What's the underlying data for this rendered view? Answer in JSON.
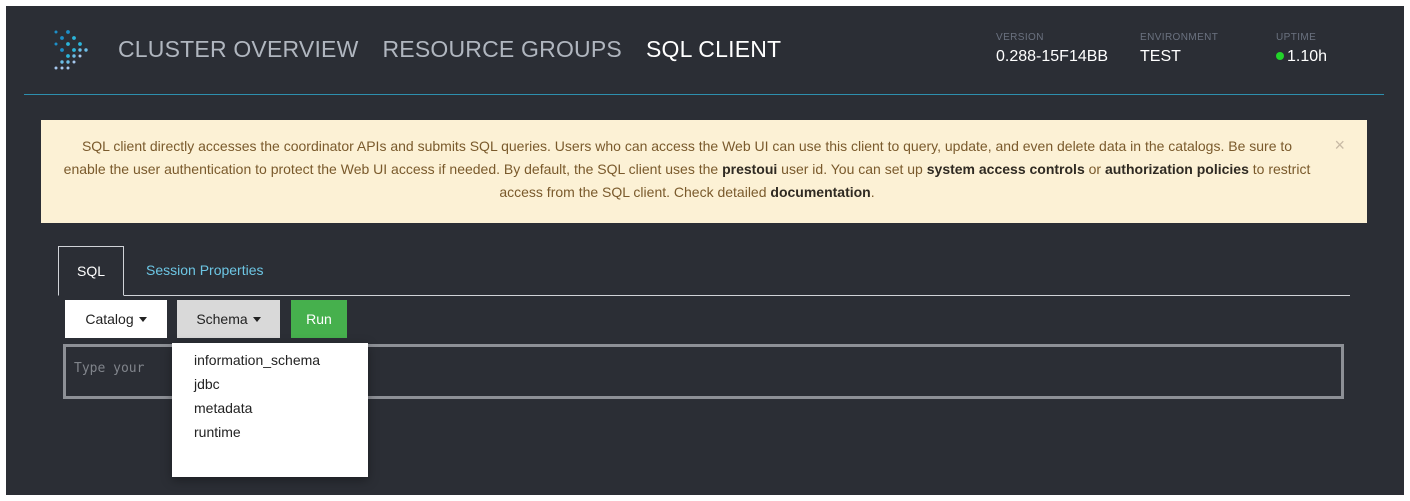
{
  "header": {
    "nav": [
      "CLUSTER OVERVIEW",
      "RESOURCE GROUPS",
      "SQL CLIENT"
    ],
    "active_nav": "SQL CLIENT",
    "version_label": "VERSION",
    "version_value": "0.288-15F14BB",
    "environment_label": "ENVIRONMENT",
    "environment_value": "TEST",
    "uptime_label": "UPTIME",
    "uptime_value": "1.10h"
  },
  "alert": {
    "text_1": "SQL client directly accesses the coordinator APIs and submits SQL queries. Users who can access the Web UI can use this client to query, update, and even delete data in the catalogs. Be sure to enable the user authentication to protect the Web UI access if needed. By default, the SQL client uses the ",
    "user_id": "prestoui",
    "text_2": " user id. You can set up ",
    "link_access": "system access controls",
    "text_3": " or ",
    "link_auth": "authorization policies",
    "text_4": " to restrict access from the SQL client. Check detailed ",
    "link_docs": "documentation",
    "text_5": ".",
    "close": "×"
  },
  "tabs": [
    "SQL",
    "Session Properties"
  ],
  "toolbar": {
    "catalog_label": "Catalog",
    "schema_label": "Schema",
    "run_label": "Run"
  },
  "editor": {
    "placeholder": "Type your"
  },
  "schema_menu": [
    "information_schema",
    "jdbc",
    "metadata",
    "runtime"
  ],
  "colors": {
    "background": "#2b2e35",
    "accent_line": "#2d8fae",
    "alert_bg": "#fcf1d5",
    "run_button": "#46b04d",
    "uptime_dot": "#22d32a",
    "link": "#6dc6e4"
  },
  "icons": {
    "logo": "presto-logo-icon",
    "alert_close": "close-icon",
    "dropdown_caret": "caret-down-icon"
  }
}
